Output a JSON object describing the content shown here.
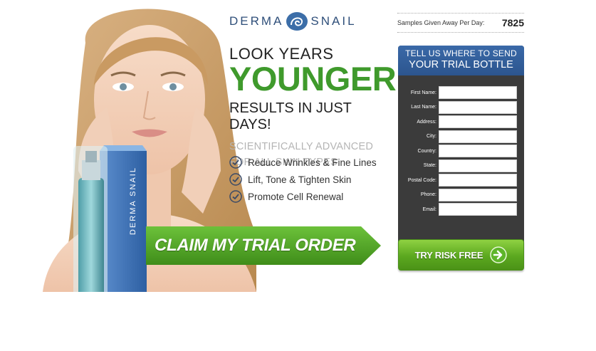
{
  "brand": {
    "left_word": "DERMA",
    "right_word": "SNAIL",
    "accent_color": "#2f4f7a"
  },
  "headline": {
    "line1": "LOOK YEARS",
    "line2": "YOUNGER",
    "line3": "RESULTS IN JUST DAYS!",
    "sub1": "SCIENTIFICALLY ADVANCED",
    "sub2": "FOR ALL SKIN TYPES",
    "green_color": "#3f9a2c"
  },
  "benefits": [
    {
      "label": "Reduce Wrinkles & Fine Lines",
      "icon": "check-circle-icon"
    },
    {
      "label": "Lift, Tone & Tighten Skin",
      "icon": "check-circle-icon"
    },
    {
      "label": "Promote Cell Renewal",
      "icon": "check-circle-icon"
    }
  ],
  "cta": {
    "claim_label": "CLAIM MY TRIAL ORDER"
  },
  "samples": {
    "label": "Samples Given Away Per Day:",
    "count": "7825"
  },
  "form": {
    "header_line1": "TELL US WHERE TO SEND",
    "header_line2": "YOUR TRIAL BOTTLE",
    "header_color": "#2f5d99",
    "panel_color": "#3b3b3b",
    "fields": [
      {
        "label": "First Name:",
        "value": ""
      },
      {
        "label": "Last Name:",
        "value": ""
      },
      {
        "label": "Address:",
        "value": ""
      },
      {
        "label": "City:",
        "value": ""
      },
      {
        "label": "Country:",
        "value": ""
      },
      {
        "label": "State:",
        "value": ""
      },
      {
        "label": "Postal Code:",
        "value": ""
      },
      {
        "label": "Phone:",
        "value": ""
      },
      {
        "label": "Email:",
        "value": ""
      }
    ],
    "submit_label": "TRY RISK FREE",
    "submit_icon": "arrow-right-circle-icon"
  },
  "product": {
    "box_label": "DERMA SNAIL"
  }
}
